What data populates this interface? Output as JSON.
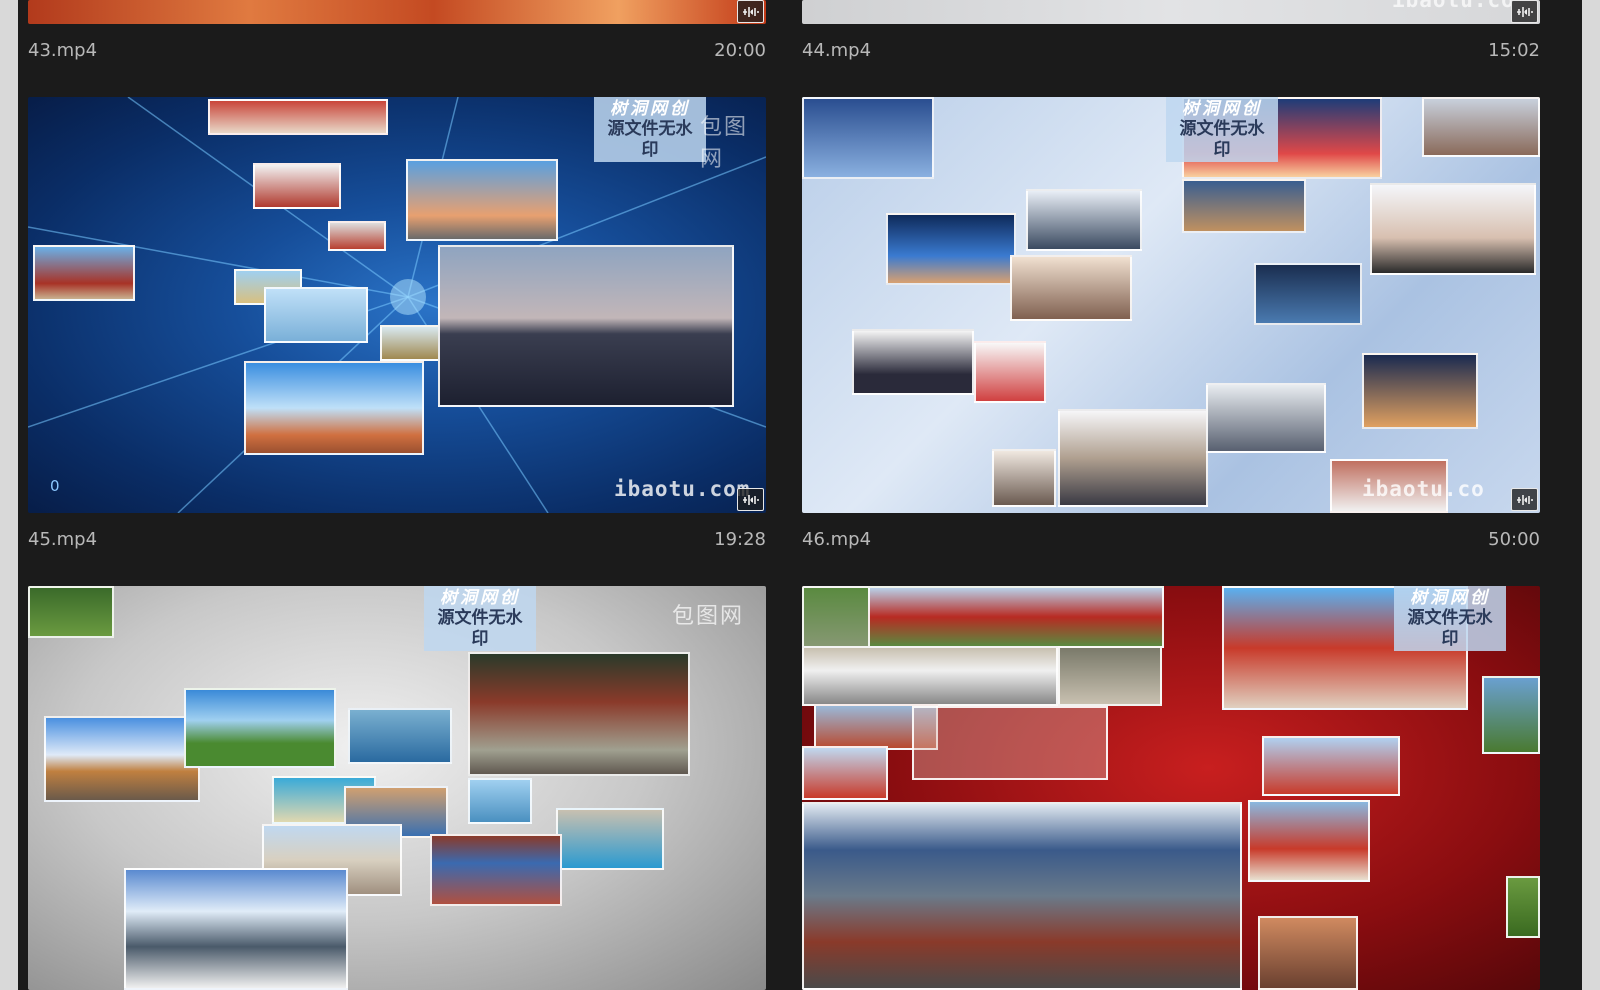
{
  "videos": [
    {
      "name": "43.mp4",
      "duration": "20:00"
    },
    {
      "name": "44.mp4",
      "duration": "15:02"
    },
    {
      "name": "45.mp4",
      "duration": "19:28"
    },
    {
      "name": "46.mp4",
      "duration": "50:00"
    },
    {
      "name": "",
      "duration": ""
    },
    {
      "name": "",
      "duration": ""
    }
  ],
  "watermark": {
    "line1": "树洞网创",
    "line2": "源文件无水印"
  },
  "logo_text": "包图网",
  "site_text": "ibaotu.com",
  "site_text_partial": "ibaotu.co",
  "thumb45_counter": "0",
  "icons": {
    "audio": "audio-track-icon"
  }
}
